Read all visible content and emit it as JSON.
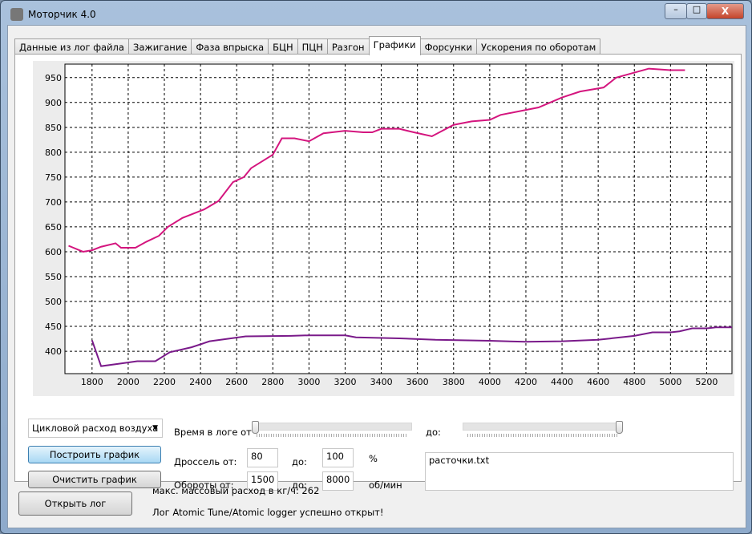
{
  "window": {
    "title": "Моторчик 4.0",
    "minimize": "–",
    "maximize": "□",
    "close": "X"
  },
  "tabs": [
    {
      "label": "Данные из лог файла"
    },
    {
      "label": "Зажигание"
    },
    {
      "label": "Фаза впрыска"
    },
    {
      "label": "БЦН"
    },
    {
      "label": "ПЦН"
    },
    {
      "label": "Разгон"
    },
    {
      "label": "Графики",
      "active": true
    },
    {
      "label": "Форсунки"
    },
    {
      "label": "Ускорения по оборотам"
    }
  ],
  "controls": {
    "param_select": "Цикловой расход воздуха",
    "build_button": "Построить график",
    "clear_button": "Очистить график",
    "time_from_label": "Время в логе от",
    "time_to_label": "до:",
    "time_from_value": 0,
    "time_to_value": 1,
    "throttle_label": "Дроссель от:",
    "throttle_from": "80",
    "throttle_to_label": "до:",
    "throttle_to": "100",
    "throttle_unit": "%",
    "rpm_label": "Обороты от:",
    "rpm_from": "1500",
    "rpm_to_label": "до:",
    "rpm_to": "8000",
    "rpm_unit": "об/мин",
    "files_text": "расточки.txt"
  },
  "footer": {
    "open_button": "Открыть лог",
    "max_flow": "макс. массовый расход в кг/ч: 262",
    "status": "Лог Atomic Tune/Atomic logger успешно открыт!"
  },
  "chart_data": {
    "type": "line",
    "xlim": [
      1650,
      5340
    ],
    "ylim": [
      355,
      977
    ],
    "xticks": [
      1800,
      2000,
      2200,
      2400,
      2600,
      2800,
      3000,
      3200,
      3400,
      3600,
      3800,
      4000,
      4200,
      4400,
      4600,
      4800,
      5000,
      5200
    ],
    "yticks": [
      400,
      450,
      500,
      550,
      600,
      650,
      700,
      750,
      800,
      850,
      900,
      950
    ],
    "grid": true,
    "series": [
      {
        "name": "pink",
        "color": "#d4157e",
        "x": [
          1670,
          1750,
          1800,
          1850,
          1930,
          1960,
          2040,
          2100,
          2170,
          2220,
          2300,
          2420,
          2500,
          2580,
          2640,
          2680,
          2800,
          2850,
          2920,
          3000,
          3080,
          3200,
          3300,
          3350,
          3400,
          3500,
          3580,
          3680,
          3800,
          3900,
          4000,
          4060,
          4200,
          4270,
          4400,
          4500,
          4630,
          4700,
          4800,
          4880,
          5000,
          5080
        ],
        "y": [
          612,
          600,
          603,
          610,
          617,
          608,
          608,
          620,
          632,
          650,
          668,
          685,
          702,
          740,
          750,
          768,
          795,
          828,
          828,
          822,
          838,
          843,
          840,
          840,
          847,
          847,
          840,
          832,
          855,
          862,
          865,
          875,
          885,
          890,
          910,
          922,
          930,
          950,
          960,
          968,
          965,
          965
        ]
      },
      {
        "name": "purple",
        "color": "#7a1a8a",
        "x": [
          1800,
          1850,
          1950,
          2050,
          2150,
          2230,
          2350,
          2450,
          2650,
          2900,
          3000,
          3200,
          3260,
          3500,
          3700,
          4000,
          4200,
          4400,
          4600,
          4800,
          4900,
          5000,
          5050,
          5120,
          5200,
          5250,
          5340
        ],
        "y": [
          422,
          370,
          375,
          380,
          380,
          398,
          408,
          420,
          430,
          431,
          432,
          432,
          428,
          426,
          423,
          421,
          419,
          420,
          423,
          431,
          438,
          438,
          440,
          446,
          446,
          448,
          448
        ]
      }
    ]
  }
}
